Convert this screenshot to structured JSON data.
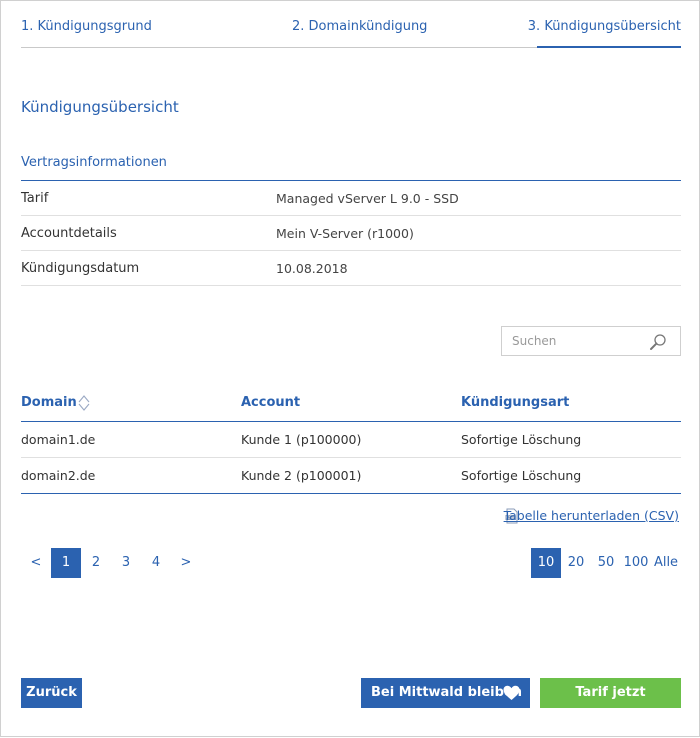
{
  "steps": {
    "step1": "1. Kündigungsgrund",
    "step2": "2. Domainkündigung",
    "step3": "3. Kündigungsübersicht"
  },
  "page_title": "Kündigungsübersicht",
  "contract": {
    "title": "Vertragsinformationen",
    "rows": [
      {
        "label": "Tarif",
        "value": "Managed vServer L 9.0 - SSD"
      },
      {
        "label": "Accountdetails",
        "value": "Mein V-Server (r1000)"
      },
      {
        "label": "Kündigungsdatum",
        "value": "10.08.2018"
      }
    ]
  },
  "search": {
    "placeholder": "Suchen",
    "value": ""
  },
  "domains_table": {
    "headers": {
      "domain": "Domain",
      "account": "Account",
      "type": "Kündigungsart"
    },
    "rows": [
      {
        "domain": "domain1.de",
        "account": "Kunde 1 (p100000)",
        "type": "Sofortige Löschung"
      },
      {
        "domain": "domain2.de",
        "account": "Kunde 2 (p100001)",
        "type": "Sofortige Löschung"
      }
    ]
  },
  "csv_link": "Tabelle herunterladen (CSV)",
  "pagination": {
    "prev": "<",
    "pages": [
      "1",
      "2",
      "3",
      "4"
    ],
    "next": ">",
    "current": "1"
  },
  "page_size": {
    "options": [
      "10",
      "20",
      "50",
      "100",
      "Alle"
    ],
    "current": "10"
  },
  "buttons": {
    "back": "Zurück",
    "stay": "Bei Mittwald bleiben",
    "cancel": "Tarif jetzt kündigen"
  },
  "colors": {
    "accent": "#2b62b0",
    "confirm": "#6cc04a"
  }
}
